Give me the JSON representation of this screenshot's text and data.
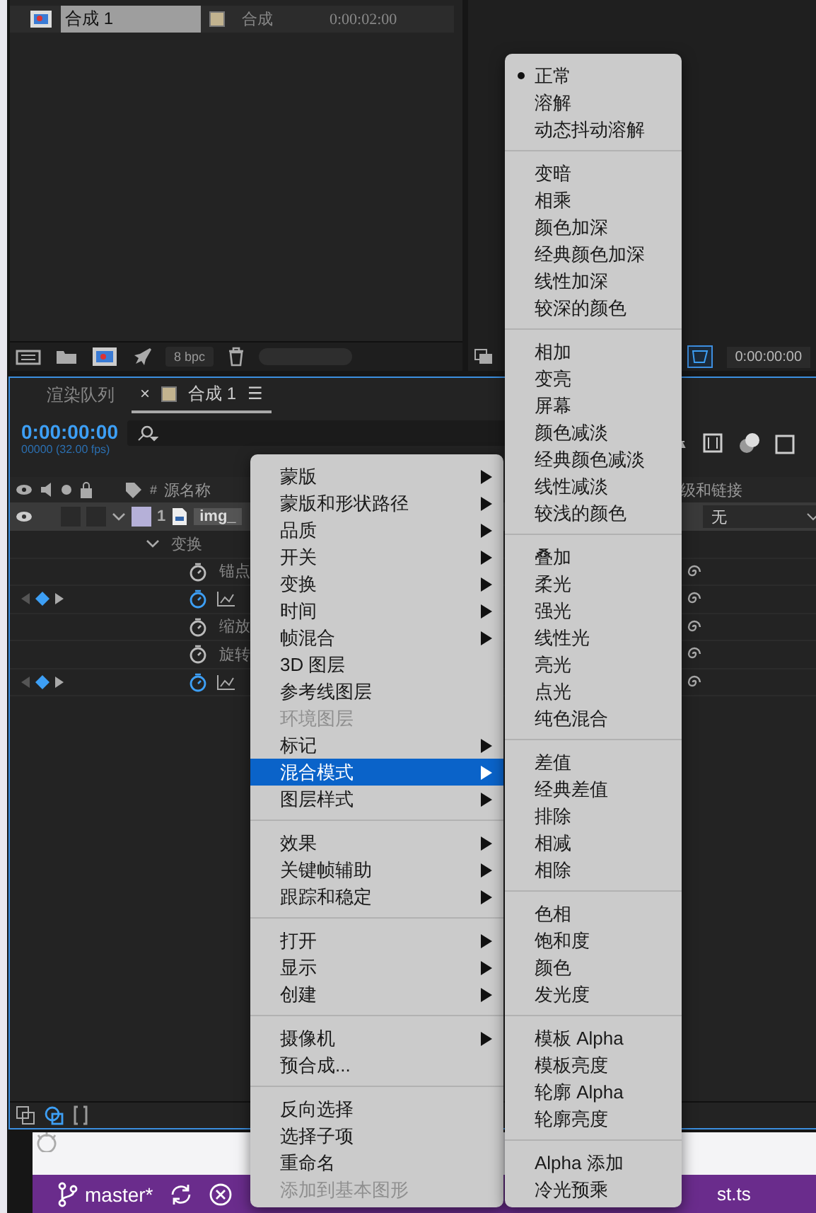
{
  "project_panel": {
    "items": [
      {
        "name": "合成 1",
        "type": "合成",
        "duration": "0:00:02:00",
        "color": "#c2b38f",
        "selected": true
      }
    ],
    "bpc": "8 bpc"
  },
  "viewer": {
    "time": "0:00:00:00"
  },
  "timeline": {
    "tabs": [
      {
        "label": "渲染队列",
        "selected": false
      },
      {
        "label": "合成 1",
        "selected": true,
        "close": "×",
        "menu": "☰",
        "color": "#c2b38f"
      }
    ],
    "timecode": "0:00:00:00",
    "frame_info": "00000 (32.00 fps)",
    "columns": {
      "hash": "#",
      "source_name": "源名称",
      "parent": "级和链接"
    },
    "layer": {
      "number": "1",
      "name": "img_",
      "color": "#b5b0d8",
      "parent": "无",
      "expanded": true
    },
    "properties": [
      {
        "label": "变换",
        "kind": "group",
        "expanded": true
      },
      {
        "label": "锚点",
        "kind": "prop",
        "animated": false
      },
      {
        "kind": "prop",
        "animated": true
      },
      {
        "label": "缩放",
        "kind": "prop",
        "animated": false
      },
      {
        "label": "旋转",
        "kind": "prop",
        "animated": false
      },
      {
        "kind": "prop",
        "animated": true
      }
    ]
  },
  "context_menu": {
    "groups": [
      [
        {
          "label": "蒙版",
          "submenu": true,
          "disabled": false,
          "selected": false
        },
        {
          "label": "蒙版和形状路径",
          "submenu": true,
          "disabled": false,
          "selected": false
        },
        {
          "label": "品质",
          "submenu": true,
          "disabled": false,
          "selected": false
        },
        {
          "label": "开关",
          "submenu": true,
          "disabled": false,
          "selected": false
        },
        {
          "label": "变换",
          "submenu": true,
          "disabled": false,
          "selected": false
        },
        {
          "label": "时间",
          "submenu": true,
          "disabled": false,
          "selected": false
        },
        {
          "label": "帧混合",
          "submenu": true,
          "disabled": false,
          "selected": false
        },
        {
          "label": "3D 图层",
          "submenu": false,
          "disabled": false,
          "selected": false
        },
        {
          "label": "参考线图层",
          "submenu": false,
          "disabled": false,
          "selected": false
        },
        {
          "label": "环境图层",
          "submenu": false,
          "disabled": true,
          "selected": false
        },
        {
          "label": "标记",
          "submenu": true,
          "disabled": false,
          "selected": false
        },
        {
          "label": "混合模式",
          "submenu": true,
          "disabled": false,
          "selected": true
        },
        {
          "label": "图层样式",
          "submenu": true,
          "disabled": false,
          "selected": false
        }
      ],
      [
        {
          "label": "效果",
          "submenu": true,
          "disabled": false,
          "selected": false
        },
        {
          "label": "关键帧辅助",
          "submenu": true,
          "disabled": false,
          "selected": false
        },
        {
          "label": "跟踪和稳定",
          "submenu": true,
          "disabled": false,
          "selected": false
        }
      ],
      [
        {
          "label": "打开",
          "submenu": true,
          "disabled": false,
          "selected": false
        },
        {
          "label": "显示",
          "submenu": true,
          "disabled": false,
          "selected": false
        },
        {
          "label": "创建",
          "submenu": true,
          "disabled": false,
          "selected": false
        }
      ],
      [
        {
          "label": "摄像机",
          "submenu": true,
          "disabled": false,
          "selected": false
        },
        {
          "label": "预合成...",
          "submenu": false,
          "disabled": false,
          "selected": false
        }
      ],
      [
        {
          "label": "反向选择",
          "submenu": false,
          "disabled": false,
          "selected": false
        },
        {
          "label": "选择子项",
          "submenu": false,
          "disabled": false,
          "selected": false
        },
        {
          "label": "重命名",
          "submenu": false,
          "disabled": false,
          "selected": false
        },
        {
          "label": "添加到基本图形",
          "submenu": false,
          "disabled": true,
          "selected": false
        }
      ]
    ]
  },
  "blend_submenu": {
    "groups": [
      [
        {
          "label": "正常",
          "checked": true
        },
        {
          "label": "溶解",
          "checked": false
        },
        {
          "label": "动态抖动溶解",
          "checked": false
        }
      ],
      [
        {
          "label": "变暗",
          "checked": false
        },
        {
          "label": "相乘",
          "checked": false
        },
        {
          "label": "颜色加深",
          "checked": false
        },
        {
          "label": "经典颜色加深",
          "checked": false
        },
        {
          "label": "线性加深",
          "checked": false
        },
        {
          "label": "较深的颜色",
          "checked": false
        }
      ],
      [
        {
          "label": "相加",
          "checked": false
        },
        {
          "label": "变亮",
          "checked": false
        },
        {
          "label": "屏幕",
          "checked": false
        },
        {
          "label": "颜色减淡",
          "checked": false
        },
        {
          "label": "经典颜色减淡",
          "checked": false
        },
        {
          "label": "线性减淡",
          "checked": false
        },
        {
          "label": "较浅的颜色",
          "checked": false
        }
      ],
      [
        {
          "label": "叠加",
          "checked": false
        },
        {
          "label": "柔光",
          "checked": false
        },
        {
          "label": "强光",
          "checked": false
        },
        {
          "label": "线性光",
          "checked": false
        },
        {
          "label": "亮光",
          "checked": false
        },
        {
          "label": "点光",
          "checked": false
        },
        {
          "label": "纯色混合",
          "checked": false
        }
      ],
      [
        {
          "label": "差值",
          "checked": false
        },
        {
          "label": "经典差值",
          "checked": false
        },
        {
          "label": "排除",
          "checked": false
        },
        {
          "label": "相减",
          "checked": false
        },
        {
          "label": "相除",
          "checked": false
        }
      ],
      [
        {
          "label": "色相",
          "checked": false
        },
        {
          "label": "饱和度",
          "checked": false
        },
        {
          "label": "颜色",
          "checked": false
        },
        {
          "label": "发光度",
          "checked": false
        }
      ],
      [
        {
          "label": "模板 Alpha",
          "checked": false
        },
        {
          "label": "模板亮度",
          "checked": false
        },
        {
          "label": "轮廓 Alpha",
          "checked": false
        },
        {
          "label": "轮廓亮度",
          "checked": false
        }
      ],
      [
        {
          "label": "Alpha 添加",
          "checked": false
        },
        {
          "label": "冷光预乘",
          "checked": false
        }
      ]
    ]
  },
  "status_bar": {
    "branch": "master*",
    "file": "st.ts"
  }
}
